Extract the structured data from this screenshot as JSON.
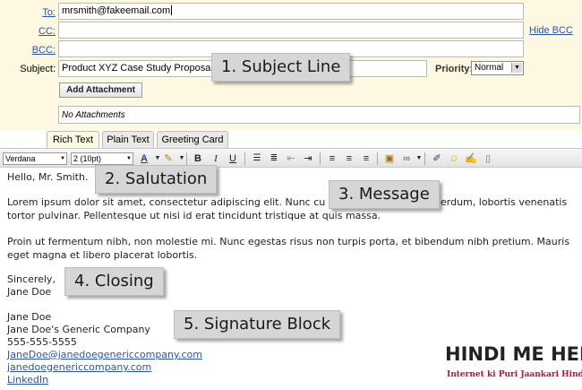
{
  "compose": {
    "to_label": "To:",
    "to_value": "mrsmith@fakeemail.com",
    "cc_label": "CC:",
    "hide_bcc": "Hide BCC",
    "bcc_label": "BCC:",
    "subject_label": "Subject:",
    "subject_value": "Product XYZ Case Study Proposal",
    "priority_label": "Priority:",
    "priority_value": "Normal",
    "add_attachment": "Add Attachment",
    "attachments_status": "No Attachments"
  },
  "tabs": [
    "Rich Text",
    "Plain Text",
    "Greeting Card"
  ],
  "active_tab": "Rich Text",
  "toolbar": {
    "font": "Verdana",
    "size": "2 (10pt)"
  },
  "message": {
    "salutation": "Hello, Mr. Smith.",
    "paragraph1": "Lorem ipsum dolor sit amet, consectetur adipiscing elit. Nunc cu...                            ...erdum, lobortis venenatis tortor pulvinar. Pellentesque ut nisi id erat tincidunt tristique at quis massa.",
    "paragraph1_a": "Lorem ipsum dolor sit amet, consectetur adipiscing elit. Nunc cu",
    "paragraph1_b": "erdum, lobortis venenatis",
    "paragraph1_c": "tortor pulvinar. Pellentesque ut nisi id erat tincidunt tristique at quis massa.",
    "paragraph2_a": "Proin ut fermentum nibh, non molestie mi. Nunc egestas risus non turpis porta, et bibendum nibh pretium. Mauris",
    "paragraph2_b": "eget magna et libero placerat lobortis.",
    "closing": "Sincerely,",
    "closing_name": "Jane Doe",
    "sig_name": "Jane Doe",
    "sig_company": "Jane Doe's Generic Company",
    "sig_phone": "555-555-5555",
    "sig_email": "JaneDoe@janedoegenericcompany.com",
    "sig_website": "janedoegenericcompany.com",
    "sig_linkedin": "LinkedIn"
  },
  "callouts": {
    "subject_line": "1. Subject Line",
    "salutation": "2. Salutation",
    "message": "3. Message",
    "closing": "4. Closing",
    "signature": "5. Signature Block"
  },
  "logo": {
    "title": "HINDI ME HELP",
    "tagline": "Internet ki Puri Jaankari Hindi Me!"
  },
  "colors": {
    "header_bg": "#fdf8e2",
    "link": "#2a55a4",
    "logo_red": "#c8102e"
  }
}
